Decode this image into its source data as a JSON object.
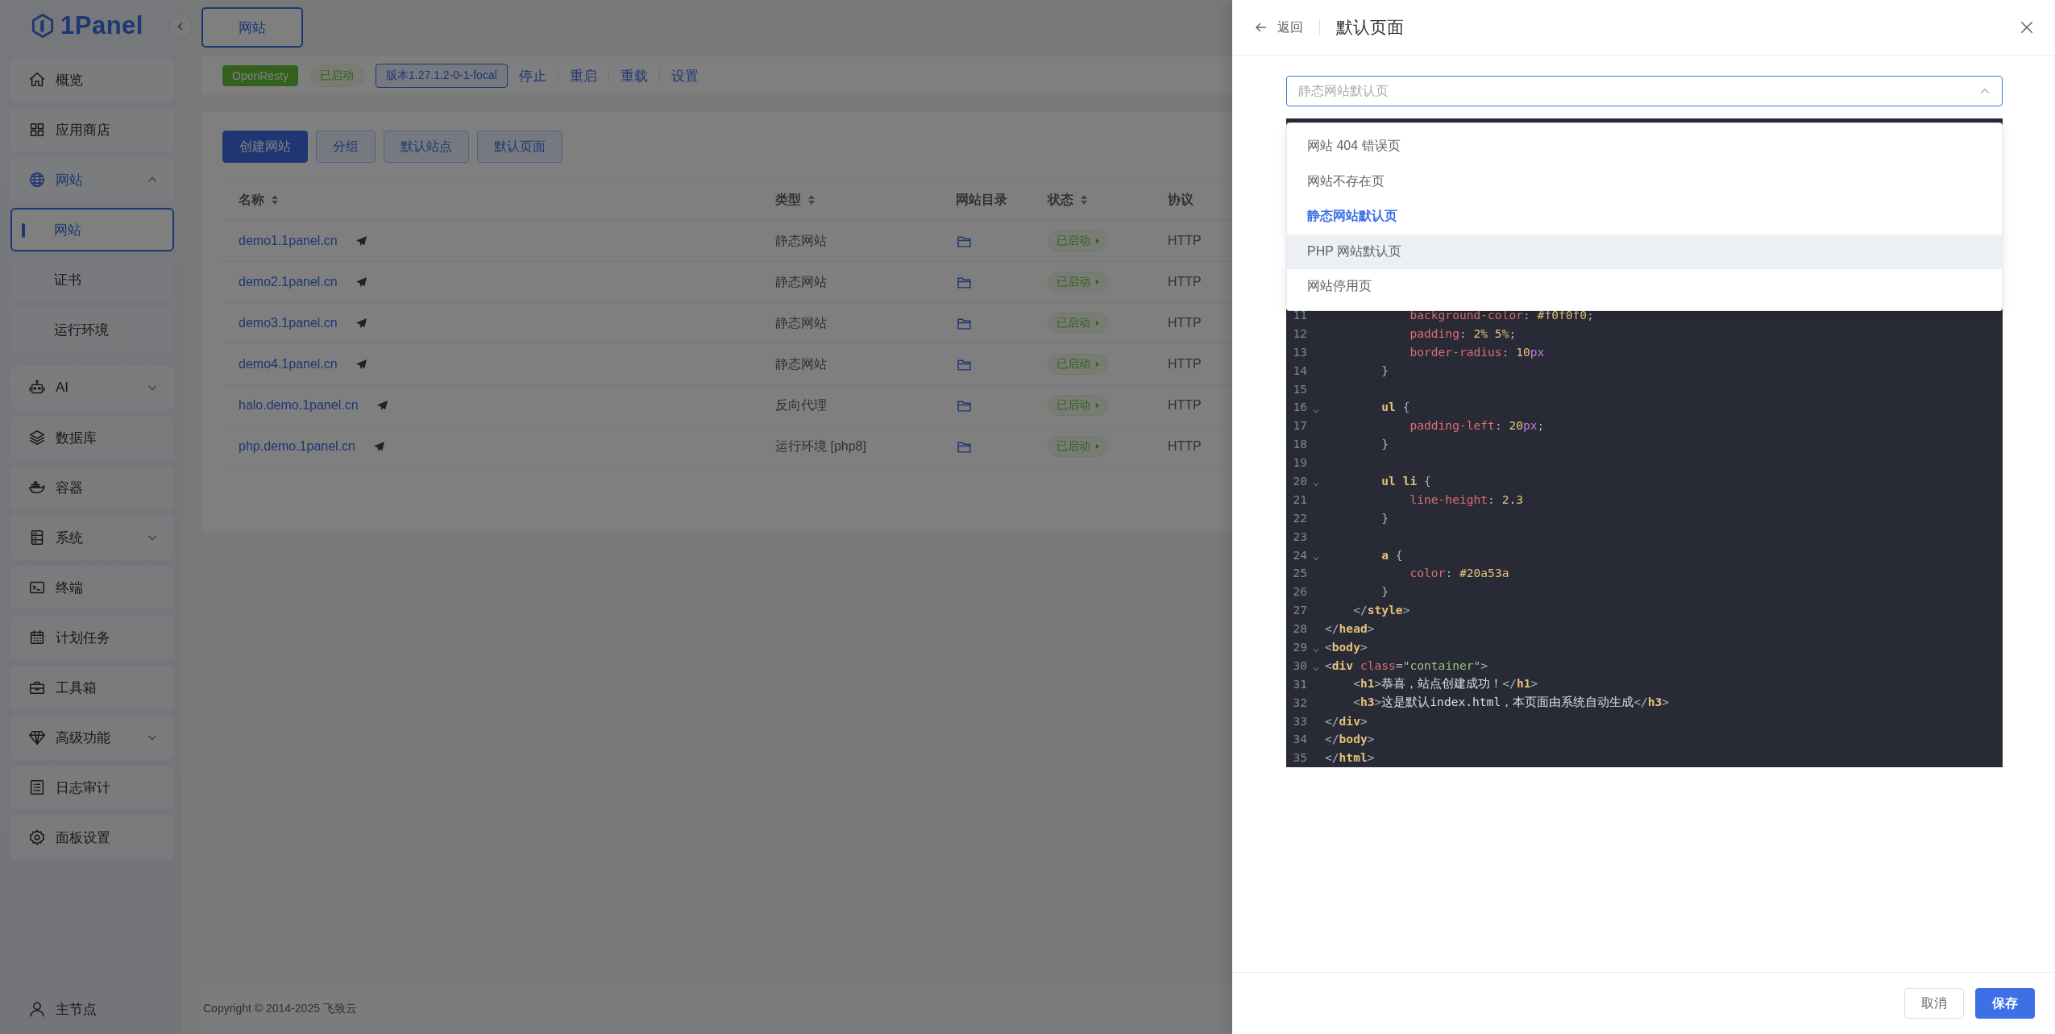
{
  "sidebar": {
    "logo": "1Panel",
    "items": [
      {
        "label": "概览",
        "selected": false
      },
      {
        "label": "应用商店",
        "selected": false
      },
      {
        "label": "网站",
        "selected": true,
        "expanded": true,
        "children": [
          {
            "label": "网站",
            "selected": true
          },
          {
            "label": "证书",
            "selected": false
          },
          {
            "label": "运行环境",
            "selected": false
          }
        ]
      },
      {
        "label": "AI",
        "selected": false,
        "expanded": false
      },
      {
        "label": "数据库",
        "selected": false
      },
      {
        "label": "容器",
        "selected": false
      },
      {
        "label": "系统",
        "selected": false,
        "expanded": false
      },
      {
        "label": "终端",
        "selected": false
      },
      {
        "label": "计划任务",
        "selected": false
      },
      {
        "label": "工具箱",
        "selected": false
      },
      {
        "label": "高级功能",
        "selected": false,
        "expanded": false
      },
      {
        "label": "日志审计",
        "selected": false
      },
      {
        "label": "面板设置",
        "selected": false
      }
    ],
    "node": "主节点"
  },
  "tabs": [
    {
      "label": "网站",
      "selected": true
    }
  ],
  "server_bar": {
    "app": "OpenResty",
    "status": "已启动",
    "version": "版本1.27.1.2-0-1-focal",
    "actions": [
      "停止",
      "重启",
      "重载",
      "设置"
    ]
  },
  "toolbar": [
    {
      "label": "创建网站",
      "kind": "primary"
    },
    {
      "label": "分组",
      "kind": "plain"
    },
    {
      "label": "默认站点",
      "kind": "plain"
    },
    {
      "label": "默认页面",
      "kind": "plain"
    }
  ],
  "table": {
    "columns": [
      {
        "label": "名称",
        "sortable": true
      },
      {
        "label": "类型",
        "sortable": true
      },
      {
        "label": "网站目录",
        "sortable": false
      },
      {
        "label": "状态",
        "sortable": true
      },
      {
        "label": "协议",
        "sortable": false
      }
    ],
    "rows": [
      {
        "name": "demo1.1panel.cn",
        "type": "静态网站",
        "status": "已启动",
        "protocol": "HTTP"
      },
      {
        "name": "demo2.1panel.cn",
        "type": "静态网站",
        "status": "已启动",
        "protocol": "HTTP"
      },
      {
        "name": "demo3.1panel.cn",
        "type": "静态网站",
        "status": "已启动",
        "protocol": "HTTP"
      },
      {
        "name": "demo4.1panel.cn",
        "type": "静态网站",
        "status": "已启动",
        "protocol": "HTTP"
      },
      {
        "name": "halo.demo.1panel.cn",
        "type": "反向代理",
        "status": "已启动",
        "protocol": "HTTP"
      },
      {
        "name": "php.demo.1panel.cn",
        "type": "运行环境 [php8]",
        "status": "已启动",
        "protocol": "HTTP"
      }
    ]
  },
  "footer": "Copyright © 2014-2025 飞致云",
  "drawer": {
    "back": "返回",
    "title": "默认页面",
    "select": {
      "placeholder": "静态网站默认页",
      "open": true
    },
    "options": [
      {
        "label": "网站 404 错误页",
        "selected": false,
        "highlighted": false
      },
      {
        "label": "网站不存在页",
        "selected": false,
        "highlighted": false
      },
      {
        "label": "静态网站默认页",
        "selected": true,
        "highlighted": false
      },
      {
        "label": "PHP 网站默认页",
        "selected": false,
        "highlighted": true
      },
      {
        "label": "网站停用页",
        "selected": false,
        "highlighted": false
      }
    ],
    "code_lines": [
      {
        "number": "11",
        "fold": false,
        "tokens": [
          {
            "kind": "prop",
            "text": "            background-color"
          },
          {
            "kind": "punct",
            "text": ": "
          },
          {
            "kind": "value",
            "text": "#f0f0f0"
          },
          {
            "kind": "punct",
            "text": ";"
          }
        ]
      },
      {
        "number": "12",
        "fold": false,
        "tokens": [
          {
            "kind": "prop",
            "text": "            padding"
          },
          {
            "kind": "punct",
            "text": ": "
          },
          {
            "kind": "value",
            "text": "2% 5%"
          },
          {
            "kind": "punct",
            "text": ";"
          }
        ]
      },
      {
        "number": "13",
        "fold": false,
        "tokens": [
          {
            "kind": "prop",
            "text": "            border-radius"
          },
          {
            "kind": "punct",
            "text": ": "
          },
          {
            "kind": "value",
            "text": "10"
          },
          {
            "kind": "unit",
            "text": "px"
          }
        ]
      },
      {
        "number": "14",
        "fold": false,
        "tokens": [
          {
            "kind": "punct",
            "text": "        }"
          }
        ]
      },
      {
        "number": "15",
        "fold": false
      },
      {
        "number": "16",
        "fold": true,
        "tokens": [
          {
            "kind": "selector",
            "text": "        ul"
          },
          {
            "kind": "punct",
            "text": " {"
          }
        ]
      },
      {
        "number": "17",
        "fold": false,
        "tokens": [
          {
            "kind": "prop",
            "text": "            padding-left"
          },
          {
            "kind": "punct",
            "text": ": "
          },
          {
            "kind": "value",
            "text": "20"
          },
          {
            "kind": "unit",
            "text": "px"
          },
          {
            "kind": "punct",
            "text": ";"
          }
        ]
      },
      {
        "number": "18",
        "fold": false,
        "tokens": [
          {
            "kind": "punct",
            "text": "        }"
          }
        ]
      },
      {
        "number": "19",
        "fold": false
      },
      {
        "number": "20",
        "fold": true,
        "tokens": [
          {
            "kind": "selector",
            "text": "        ul li"
          },
          {
            "kind": "punct",
            "text": " {"
          }
        ]
      },
      {
        "number": "21",
        "fold": false,
        "tokens": [
          {
            "kind": "prop",
            "text": "            line-height"
          },
          {
            "kind": "punct",
            "text": ": "
          },
          {
            "kind": "value",
            "text": "2.3"
          }
        ]
      },
      {
        "number": "22",
        "fold": false,
        "tokens": [
          {
            "kind": "punct",
            "text": "        }"
          }
        ]
      },
      {
        "number": "23",
        "fold": false
      },
      {
        "number": "24",
        "fold": true,
        "tokens": [
          {
            "kind": "selector",
            "text": "        a"
          },
          {
            "kind": "punct",
            "text": " {"
          }
        ]
      },
      {
        "number": "25",
        "fold": false,
        "tokens": [
          {
            "kind": "prop",
            "text": "            color"
          },
          {
            "kind": "punct",
            "text": ": "
          },
          {
            "kind": "value",
            "text": "#20a53a"
          }
        ]
      },
      {
        "number": "26",
        "fold": false,
        "tokens": [
          {
            "kind": "punct",
            "text": "        }"
          }
        ]
      },
      {
        "number": "27",
        "fold": false,
        "tokens": [
          {
            "kind": "punct",
            "text": "    </"
          },
          {
            "kind": "tag",
            "text": "style"
          },
          {
            "kind": "punct",
            "text": ">"
          }
        ]
      },
      {
        "number": "28",
        "fold": false,
        "tokens": [
          {
            "kind": "punct",
            "text": "</"
          },
          {
            "kind": "tag",
            "text": "head"
          },
          {
            "kind": "punct",
            "text": ">"
          }
        ]
      },
      {
        "number": "29",
        "fold": true,
        "tokens": [
          {
            "kind": "punct",
            "text": "<"
          },
          {
            "kind": "tag",
            "text": "body"
          },
          {
            "kind": "punct",
            "text": ">"
          }
        ]
      },
      {
        "number": "30",
        "fold": true,
        "tokens": [
          {
            "kind": "punct",
            "text": "<"
          },
          {
            "kind": "tag",
            "text": "div"
          },
          {
            "kind": "attr",
            "text": " class"
          },
          {
            "kind": "punct",
            "text": "="
          },
          {
            "kind": "string",
            "text": "\"container\""
          },
          {
            "kind": "punct",
            "text": ">"
          }
        ]
      },
      {
        "number": "31",
        "fold": false,
        "tokens": [
          {
            "kind": "punct",
            "text": "    <"
          },
          {
            "kind": "tag",
            "text": "h1"
          },
          {
            "kind": "punct",
            "text": ">"
          },
          {
            "kind": "text",
            "text": "恭喜，站点创建成功！"
          },
          {
            "kind": "punct",
            "text": "</"
          },
          {
            "kind": "tag",
            "text": "h1"
          },
          {
            "kind": "punct",
            "text": ">"
          }
        ]
      },
      {
        "number": "32",
        "fold": false,
        "tokens": [
          {
            "kind": "punct",
            "text": "    <"
          },
          {
            "kind": "tag",
            "text": "h3"
          },
          {
            "kind": "punct",
            "text": ">"
          },
          {
            "kind": "text",
            "text": "这是默认index.html，本页面由系统自动生成"
          },
          {
            "kind": "punct",
            "text": "</"
          },
          {
            "kind": "tag",
            "text": "h3"
          },
          {
            "kind": "punct",
            "text": ">"
          }
        ]
      },
      {
        "number": "33",
        "fold": false,
        "tokens": [
          {
            "kind": "punct",
            "text": "</"
          },
          {
            "kind": "tag",
            "text": "div"
          },
          {
            "kind": "punct",
            "text": ">"
          }
        ]
      },
      {
        "number": "34",
        "fold": false,
        "tokens": [
          {
            "kind": "punct",
            "text": "</"
          },
          {
            "kind": "tag",
            "text": "body"
          },
          {
            "kind": "punct",
            "text": ">"
          }
        ]
      },
      {
        "number": "35",
        "fold": false,
        "tokens": [
          {
            "kind": "punct",
            "text": "</"
          },
          {
            "kind": "tag",
            "text": "html"
          },
          {
            "kind": "punct",
            "text": ">"
          }
        ]
      }
    ],
    "buttons": [
      {
        "label": "取消",
        "kind": "plain"
      },
      {
        "label": "保存",
        "kind": "primary"
      }
    ]
  }
}
